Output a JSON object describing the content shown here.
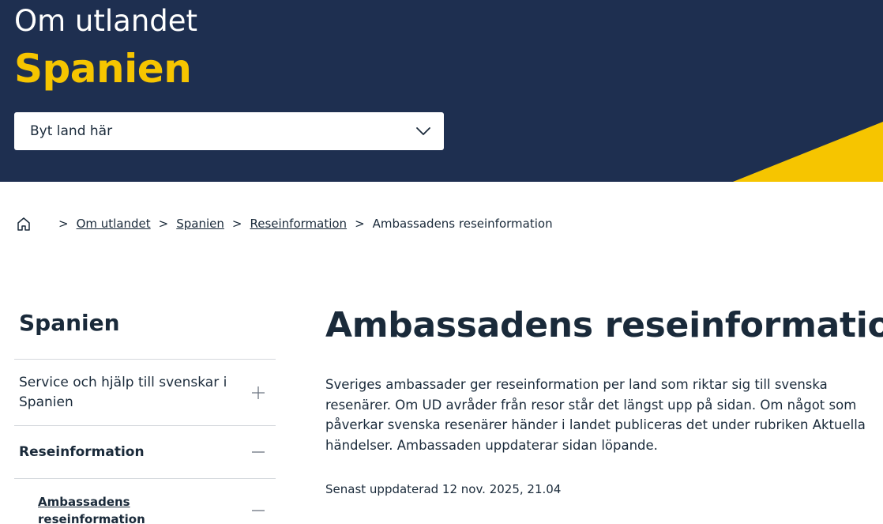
{
  "hero": {
    "kicker": "Om utlandet",
    "title": "Spanien",
    "country_select": {
      "label": "Byt land här",
      "icon": "chevron-down-icon"
    }
  },
  "breadcrumb": {
    "home_icon": "home-icon",
    "items": [
      "Om utlandet",
      "Spanien",
      "Reseinformation"
    ],
    "current": "Ambassadens reseinformation",
    "separator": ">"
  },
  "sidenav": {
    "heading": "Spanien",
    "items": [
      {
        "label": "Service och hjälp till svenskar i Spanien",
        "icon": "plus-icon"
      },
      {
        "label": "Reseinformation",
        "icon": "minus-icon"
      }
    ],
    "subitems": [
      {
        "label": "Ambassadens reseinformation",
        "icon": "minus-icon"
      }
    ]
  },
  "main": {
    "title": "Ambassadens reseinformation",
    "intro": "Sveriges ambassader ger reseinformation per land som riktar sig till svenska resenärer. Om UD avråder från resor står det längst upp på sidan. Om något som påverkar svenska resenärer händer i landet publiceras det under rubriken Aktuella händelser. Ambassaden uppdaterar sidan löpande.",
    "updated": "Senast uppdaterad 12 nov. 2025, 21.04"
  },
  "colors": {
    "hero_background": "#1e2f50",
    "accent_yellow": "#f6c500",
    "text": "#1a2a3a",
    "divider": "#d4d8dd"
  }
}
